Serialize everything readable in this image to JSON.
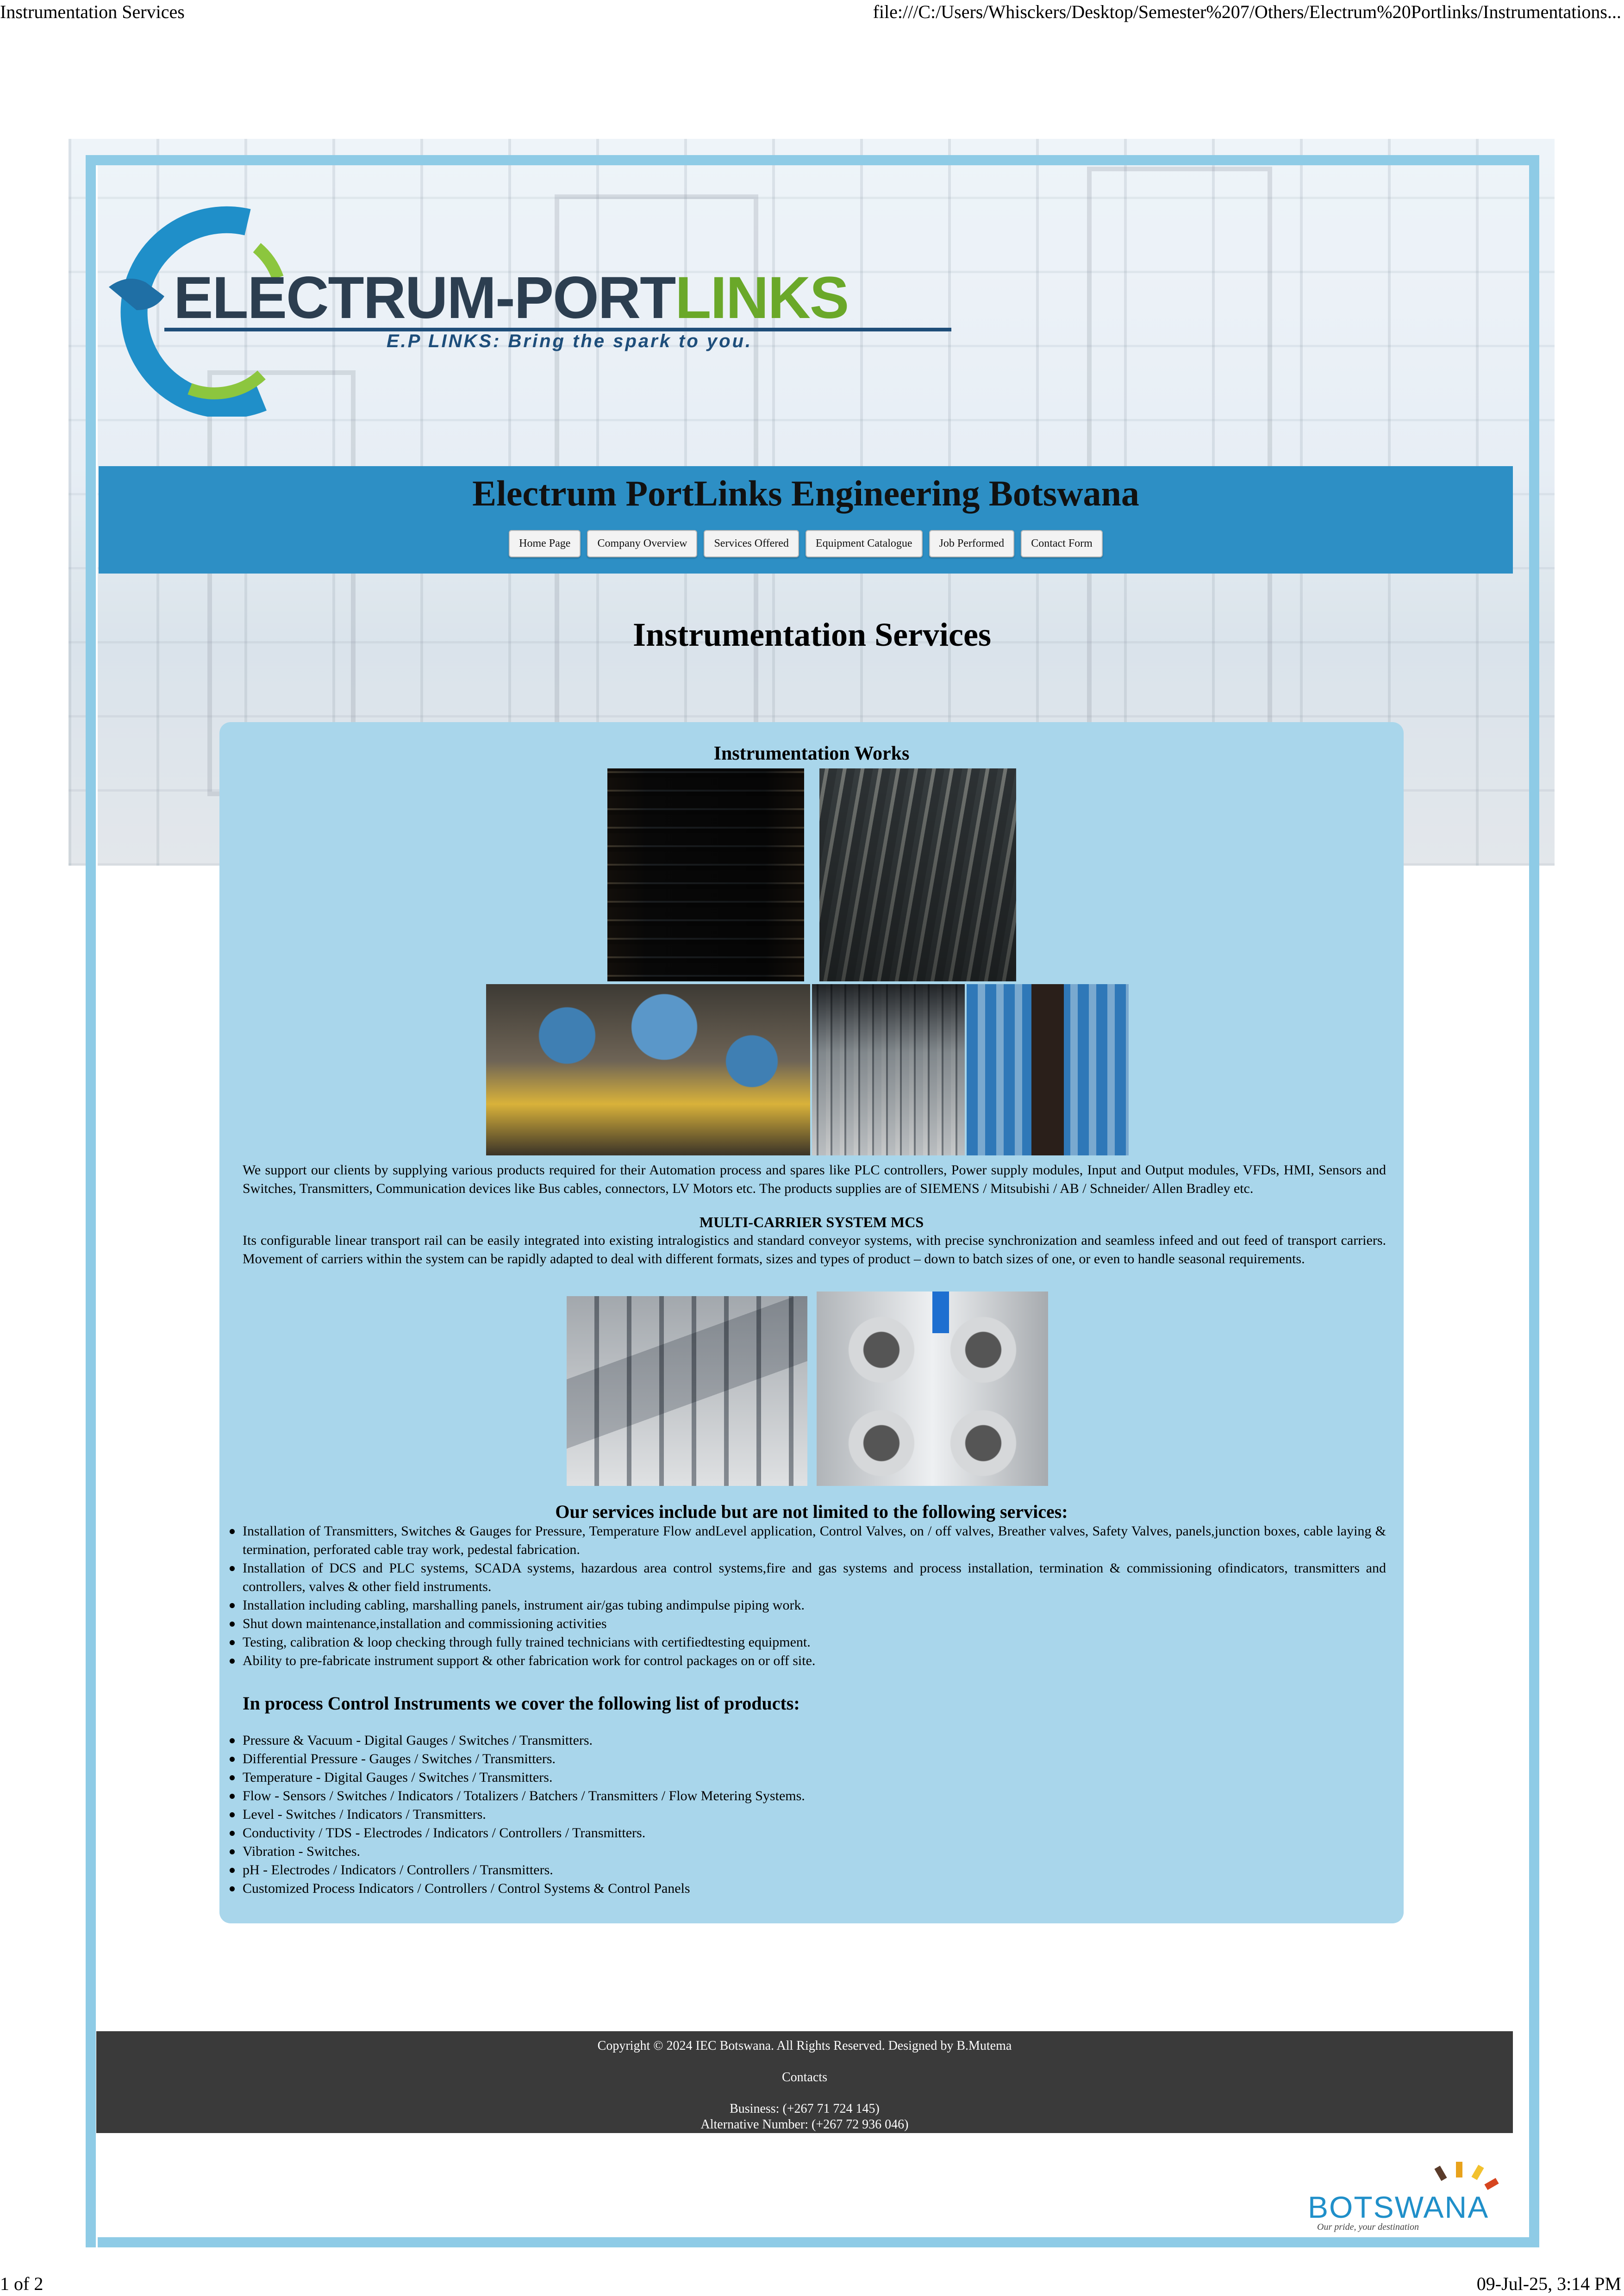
{
  "print": {
    "page_title": "Instrumentation Services",
    "url": "file:///C:/Users/Whisckers/Desktop/Semester%207/Others/Electrum%20Portlinks/Instrumentations...",
    "page_count": "1 of 2",
    "datetime": "09-Jul-25, 3:14 PM"
  },
  "logo": {
    "name_part1": "ELECTRUM-PORT",
    "name_part2": "LINKS",
    "tagline": "E.P LINKS: Bring the spark to you.",
    "colors": {
      "primary": "#2c3e50",
      "accent": "#6aa829",
      "ring": "#1f8fc9"
    }
  },
  "header": {
    "site_title": "Electrum PortLinks Engineering Botswana",
    "banner_color": "#2d8fc5",
    "nav": [
      {
        "label": "Home Page"
      },
      {
        "label": "Company Overview"
      },
      {
        "label": "Services Offered"
      },
      {
        "label": "Equipment Catalogue"
      },
      {
        "label": "Job Performed"
      },
      {
        "label": "Contact Form"
      }
    ]
  },
  "main": {
    "page_heading": "Instrumentation Services",
    "panel_color": "#a9d6eb",
    "works_title": "Instrumentation Works",
    "intro_paragraph": "We support our clients by supplying various products required for their Automation process and spares like PLC controllers, Power supply modules, Input and Output modules, VFDs, HMI, Sensors and Switches, Transmitters, Communication devices like Bus cables, connectors, LV Motors etc. The products supplies are of SIEMENS / Mitsubishi / AB / Schneider/ Allen Bradley etc.",
    "mcs_title": "MULTI-CARRIER SYSTEM MCS",
    "mcs_paragraph": "Its configurable linear transport rail can be easily integrated into existing intralogistics and standard conveyor systems, with precise synchronization and seamless infeed and out feed of transport carriers. Movement of carriers within the system can be rapidly adapted to deal with different formats, sizes and types of product – down to batch sizes of one, or even to handle seasonal requirements.",
    "services_title": "Our services include but are not limited to the following services:",
    "services": [
      "Installation of Transmitters, Switches & Gauges for Pressure, Temperature Flow andLevel application, Control Valves, on / off valves, Breather valves, Safety Valves, panels,junction boxes, cable laying & termination, perforated cable tray work, pedestal fabrication.",
      "Installation of DCS and PLC systems, SCADA systems, hazardous area control systems,fire and gas systems and process installation, termination & commissioning ofindicators, transmitters and controllers, valves & other field instruments.",
      "Installation including cabling, marshalling panels, instrument air/gas tubing andimpulse piping work.",
      "Shut down maintenance,installation and commissioning activities",
      "Testing, calibration & loop checking through fully trained technicians with certifiedtesting equipment.",
      "Ability to pre-fabricate instrument support & other fabrication work for control packages on or off site."
    ],
    "products_title": "In process Control Instruments we cover the following list of products:",
    "products": [
      "Pressure & Vacuum - Digital Gauges / Switches / Transmitters.",
      "Differential Pressure - Gauges / Switches / Transmitters.",
      "Temperature - Digital Gauges / Switches / Transmitters.",
      "Flow - Sensors / Switches / Indicators / Totalizers / Batchers / Transmitters / Flow Metering Systems.",
      "Level - Switches / Indicators / Transmitters.",
      "Conductivity / TDS - Electrodes / Indicators / Controllers / Transmitters.",
      "Vibration - Switches.",
      "pH - Electrodes / Indicators / Controllers / Transmitters.",
      "Customized Process Indicators / Controllers / Control Systems & Control Panels"
    ]
  },
  "footer": {
    "copyright": "Copyright © 2024 IEC Botswana. All Rights Reserved. Designed by B.Mutema",
    "contacts_label": "Contacts",
    "business": "Business: (+267 71 724 145)",
    "alternative": "Alternative Number: (+267 72 936 046)",
    "background": "#3a3a3a"
  },
  "badge": {
    "name": "BOTSWANA",
    "tagline": "Our pride, your destination"
  }
}
